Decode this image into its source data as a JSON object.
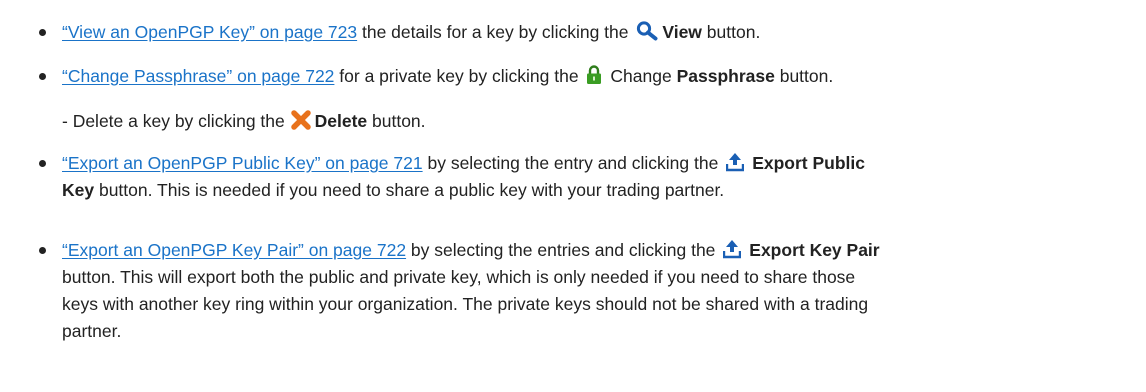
{
  "items": [
    {
      "link": "“View an OpenPGP Key” on page 723",
      "before": " the details for a key by clicking the ",
      "icon": "magnifier-icon",
      "bold": "View",
      "after": " button."
    },
    {
      "link": "“Change Passphrase” on page 722",
      "before": " for a private key by clicking the ",
      "icon": "padlock-icon",
      "plain": "Change ",
      "bold": "Passphrase",
      "after": " button."
    },
    {
      "prefix": "- Delete a key by clicking the ",
      "icon": "red-x-delete-icon",
      "bold": "Delete",
      "after": " button."
    },
    {
      "link": "“Export an OpenPGP Public Key” on page 721",
      "before": " by selecting the entry and clicking the ",
      "icon": "upload-arrow-icon",
      "bold_line1": "Export Public",
      "bold_line2": "Key",
      "after": " button. This is needed if you need to share a public key with your trading partner."
    },
    {
      "link": "“Export an OpenPGP Key Pair” on page 722",
      "before": " by selecting the entries and clicking the ",
      "icon": "upload-arrow-icon",
      "bold": "Export Key Pair",
      "line2": "button. This will export both the public and private key, which is only needed if you need to share those",
      "line3": "keys with another key ring within your organization. The private keys should not be shared with a trading",
      "line4": "partner."
    }
  ],
  "colors": {
    "link": "#1a73c8",
    "text": "#222222",
    "icon_blue": "#1a5fb4",
    "lock_green": "#3a9d23",
    "delete_orange": "#e8721c"
  }
}
